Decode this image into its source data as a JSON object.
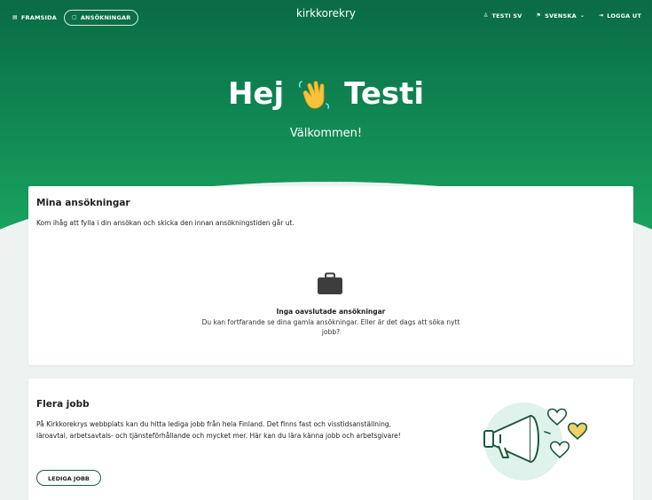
{
  "nav": {
    "home_label": "FRAMSIDA",
    "applications_label": "ANSÖKNINGAR",
    "brand": "kirkkorekry",
    "user_label": "TESTI SV",
    "language_label": "SVENSKA",
    "logout_label": "LOGGA UT"
  },
  "hero": {
    "greeting_hello": "Hej",
    "greeting_name": "Testi",
    "welcome": "Välkommen!"
  },
  "applications": {
    "title": "Mina ansökningar",
    "reminder": "Kom ihåg att fylla i din ansökan och skicka den innan ansökningstiden går ut.",
    "empty_title": "Inga oavslutade ansökningar",
    "empty_text": "Du kan fortfarande se dina gamla ansökningar. Eller är det dags att söka nytt jobb?"
  },
  "jobs": {
    "title": "Flera jobb",
    "text": "På Kirkkorekrys webbplats kan du hitta lediga jobb från hela Finland. Det finns fast och visstidsanställning, läroavtal, arbetsavtals- och tjänsteförhållande och mycket mer. Här kan du lära känna jobb och arbetsgivare!",
    "button_label": "LEDIGA JOBB"
  },
  "icons": {
    "home": "home-icon",
    "applications": "document-icon",
    "user": "user-icon",
    "language": "flag-icon",
    "logout": "logout-icon",
    "wave": "waving-hand-icon",
    "briefcase": "briefcase-icon",
    "megaphone": "megaphone-hearts-illustration"
  },
  "colors": {
    "hero_top": "#0a6b44",
    "hero_bottom": "#1aa25f",
    "accent_dark": "#1e5a3c",
    "heart_yellow": "#f2cf6b",
    "illustration_mint": "#dff2ec"
  }
}
